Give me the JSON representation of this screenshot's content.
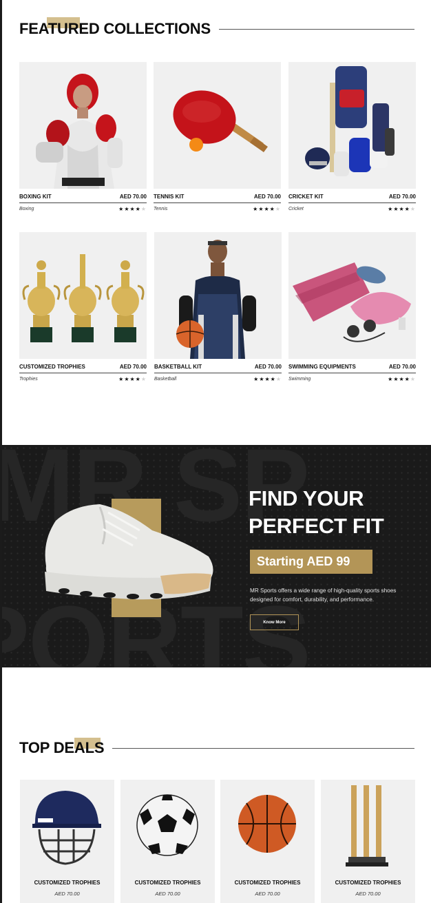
{
  "featured": {
    "title": "FEATURED COLLECTIONS",
    "products": [
      {
        "name": "BOXING KIT",
        "price": "AED 70.00",
        "category": "Boxing",
        "rating": 4,
        "image_icon": "boxer-image"
      },
      {
        "name": "TENNIS KIT",
        "price": "AED 70.00",
        "category": "Tennis",
        "rating": 4,
        "image_icon": "table-tennis-paddle-image"
      },
      {
        "name": "CRICKET KIT",
        "price": "AED 70.00",
        "category": "Cricket",
        "rating": 4,
        "image_icon": "cricket-kit-image"
      },
      {
        "name": "CUSTOMIZED TROPHIES",
        "price": "AED 70.00",
        "category": "Trophies",
        "rating": 4,
        "image_icon": "trophies-image"
      },
      {
        "name": "BASKETBALL KIT",
        "price": "AED 70.00",
        "category": "Basketball",
        "rating": 4,
        "image_icon": "basketball-player-image"
      },
      {
        "name": "SWIMMING EQUIPMENTS",
        "price": "AED 70.00",
        "category": "Swimming",
        "rating": 4,
        "image_icon": "swimming-gear-image"
      }
    ]
  },
  "hero": {
    "background_text_top": "MR SP",
    "background_text_bottom": "PORTS",
    "headline_line1": "FIND YOUR",
    "headline_line2": "PERFECT FIT",
    "price_label": "Starting AED 99",
    "description": "MR Sports offers a wide range of high-quality sports shoes designed for comfort, durability, and performance.",
    "button_label": "Know More",
    "image_icon": "running-shoe-image"
  },
  "deals": {
    "title": "TOP DEALS",
    "items": [
      {
        "name": "CUSTOMIZED TROPHIES",
        "price": "AED 70.00",
        "image_icon": "cricket-helmet-image"
      },
      {
        "name": "CUSTOMIZED TROPHIES",
        "price": "AED 70.00",
        "image_icon": "soccer-ball-image"
      },
      {
        "name": "CUSTOMIZED TROPHIES",
        "price": "AED 70.00",
        "image_icon": "basketball-image"
      },
      {
        "name": "CUSTOMIZED TROPHIES",
        "price": "AED 70.00",
        "image_icon": "cricket-stumps-image"
      }
    ]
  },
  "colors": {
    "gold": "#b39557",
    "gold_light": "#cdb47a",
    "dark_bg": "#1a1a1a",
    "card_bg": "#f0f0f0"
  }
}
